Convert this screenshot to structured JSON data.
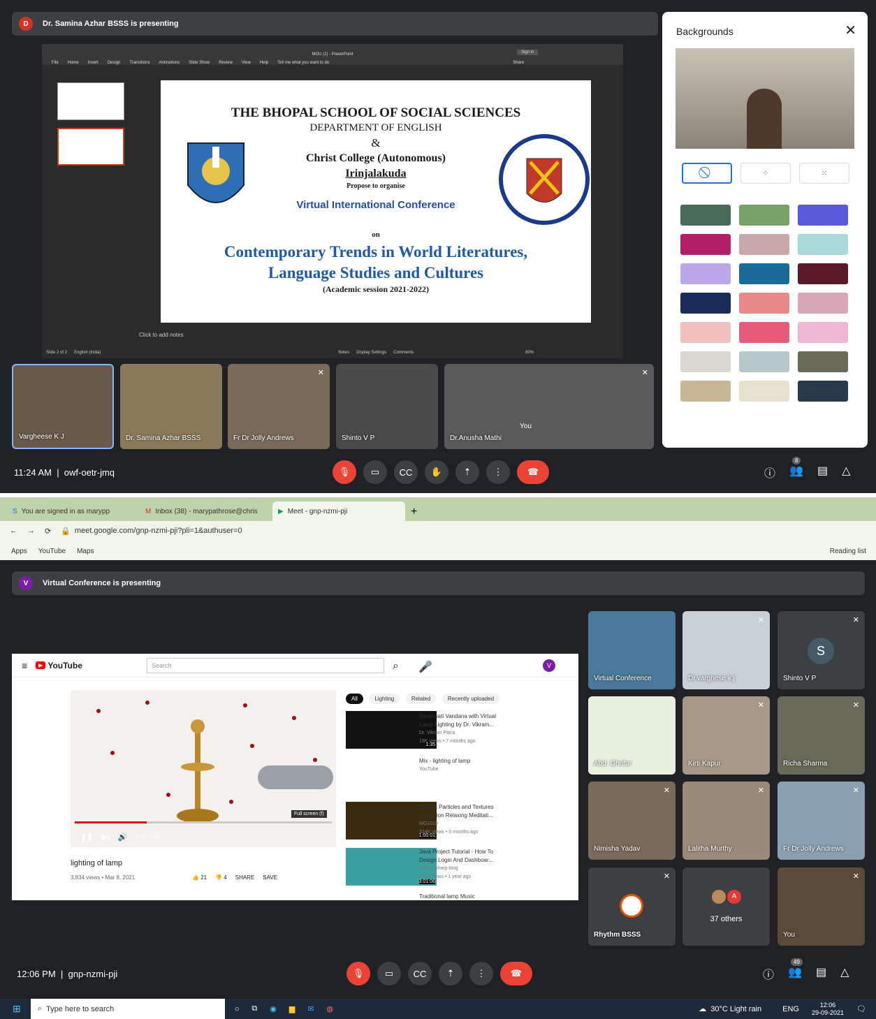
{
  "top": {
    "presenter_initial": "D",
    "presenter_banner": "Dr. Samina Azhar BSSS is presenting",
    "ppt": {
      "title": "MOU (2) - PowerPoint",
      "signin": "Sign in",
      "menu": [
        "File",
        "Home",
        "Insert",
        "Design",
        "Transitions",
        "Animations",
        "Slide Show",
        "Review",
        "View",
        "Help"
      ],
      "tell": "Tell me what you want to do",
      "share": "Share",
      "notes": "Click to add notes",
      "status_left": "Slide 2 of 2",
      "lang": "English (India)",
      "status_right": [
        "Notes",
        "Display Settings",
        "Comments"
      ],
      "zoom": "80%"
    },
    "slide": {
      "l1": "THE BHOPAL SCHOOL OF SOCIAL SCIENCES",
      "l2": "DEPARTMENT OF ENGLISH",
      "amp": "&",
      "l3": "Christ College (Autonomous)",
      "l4": "Irinjalakuda",
      "l5": "Propose to organise",
      "l6": "Virtual International Conference",
      "on": "on",
      "l7": "Contemporary Trends in World Literatures,",
      "l8": "Language Studies and Cultures",
      "l9": "(Academic session 2021-2022)"
    },
    "backgrounds_title": "Backgrounds",
    "participants": [
      "Vargheese K J",
      "Dr. Samina Azhar BSSS",
      "Fr Dr Jolly Andrews",
      "Shinto V P",
      "Dr.Anusha Mathi",
      "You"
    ],
    "time": "11:24 AM",
    "code": "owf-oetr-jmq",
    "people_count": "8"
  },
  "browser": {
    "tabs": [
      "You are signed in as marypp",
      "Inbox (38) - marypathrose@chris",
      "Meet - gnp-nzmi-pji"
    ],
    "url": "meet.google.com/gnp-nzmi-pji?pli=1&authuser=0",
    "bookmarks": [
      "Apps",
      "YouTube",
      "Maps"
    ],
    "reading": "Reading list"
  },
  "bottom": {
    "presenter_initial": "V",
    "presenter_banner": "Virtual Conference is presenting",
    "yt": {
      "logo": "YouTube",
      "search": "Search",
      "chips": [
        "All",
        "Lighting",
        "Related",
        "Recently uploaded"
      ],
      "video_title": "lighting of lamp",
      "video_meta": "3,834 views • Mar 8, 2021",
      "likes": "21",
      "dislikes": "4",
      "share": "SHARE",
      "save": "SAVE",
      "time": "0:49 / 3:09",
      "fullscreen": "Full screen (f)",
      "side": [
        {
          "t": "Saraswati Vandana with Virtual Lamp Lighting by Dr. Vikram...",
          "c": "Dr. Vikram Patra",
          "m": "19K views • 7 months ago",
          "d": "1:35"
        },
        {
          "t": "Mix - lighting of lamp",
          "c": "YouTube",
          "m": "",
          "d": ""
        },
        {
          "t": "Golden Particles and Textures Animation Relaxing Meditati...",
          "c": "MG1010",
          "m": "314K views • 3 months ago",
          "d": "1:00:01"
        },
        {
          "t": "Java Project Tutorial - How To Design Login And Dashboar...",
          "c": "1BestCsharp blog",
          "m": "5.1M views • 1 year ago",
          "d": "3:01:06"
        },
        {
          "t": "Traditional lamp Music",
          "c": "",
          "m": "",
          "d": ""
        }
      ]
    },
    "participants": [
      "Virtual Conference",
      "Dr.varghese k.j",
      "Shinto V P",
      "Abd. Ghofur",
      "Kirti Kapur",
      "Richa Sharma",
      "Nimisha Yadav",
      "Lalitha Murthy",
      "Fr Dr Jolly Andrews",
      "Rhythm BSSS",
      "37 others",
      "You"
    ],
    "shinto_initial": "S",
    "others_initial": "A",
    "time": "12:06 PM",
    "code": "gnp-nzmi-pji",
    "people_count": "49"
  },
  "taskbar": {
    "search": "Type here to search",
    "weather": "30°C  Light rain",
    "lang": "ENG",
    "time": "12:06",
    "date": "29-09-2021"
  }
}
